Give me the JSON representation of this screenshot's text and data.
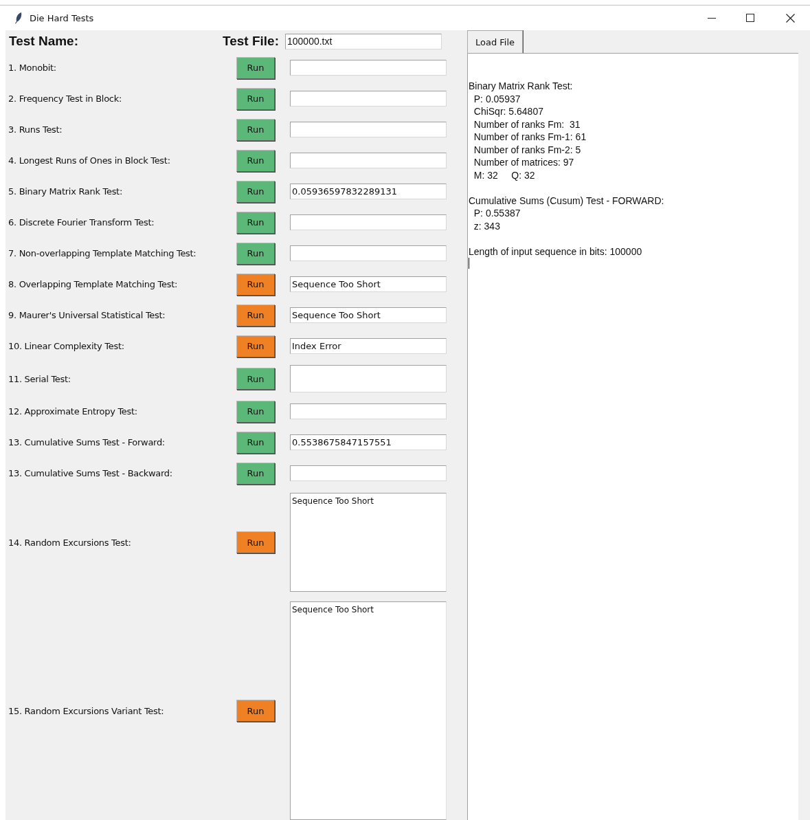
{
  "window": {
    "title": "Die Hard Tests"
  },
  "header": {
    "name_label": "Test Name:",
    "file_label": "Test File:",
    "file_value": "100000.txt"
  },
  "load_button": "Load File",
  "tests": [
    {
      "name": "1. Monobit:",
      "button": "Run",
      "color": "#5cb879",
      "kind": "entry"
    },
    {
      "name": "2. Frequency Test in Block:",
      "button": "Run",
      "color": "#5cb879",
      "kind": "entry"
    },
    {
      "name": "3. Runs Test:",
      "button": "Run",
      "color": "#5cb879",
      "kind": "entry"
    },
    {
      "name": "4. Longest Runs of Ones in Block Test:",
      "button": "Run",
      "color": "#5cb879",
      "kind": "entry"
    },
    {
      "name": "5. Binary Matrix Rank Test:",
      "button": "Run",
      "color": "#5cb879",
      "kind": "entry",
      "result": "0.05936597832289131"
    },
    {
      "name": "6. Discrete Fourier Transform Test:",
      "button": "Run",
      "color": "#5cb879",
      "kind": "entry"
    },
    {
      "name": "7. Non-overlapping Template Matching Test:",
      "button": "Run",
      "color": "#5cb879",
      "kind": "entry"
    },
    {
      "name": "8. Overlapping Template Matching Test:",
      "button": "Run",
      "color": "#f08024",
      "kind": "entry",
      "result": "Sequence Too Short"
    },
    {
      "name": "9. Maurer's Universal Statistical Test:",
      "button": "Run",
      "color": "#f08024",
      "kind": "entry",
      "result": "Sequence Too Short"
    },
    {
      "name": "10. Linear Complexity Test:",
      "button": "Run",
      "color": "#f08024",
      "kind": "entry",
      "result": "Index Error"
    },
    {
      "name": "11. Serial Test:",
      "button": "Run",
      "color": "#5cb879",
      "kind": "double"
    },
    {
      "name": "12. Approximate Entropy Test:",
      "button": "Run",
      "color": "#5cb879",
      "kind": "entry"
    },
    {
      "name": "13. Cumulative Sums Test - Forward:",
      "button": "Run",
      "color": "#5cb879",
      "kind": "entry",
      "result": "0.5538675847157551"
    },
    {
      "name": "13. Cumulative Sums Test - Backward:",
      "button": "Run",
      "color": "#5cb879",
      "kind": "entry"
    },
    {
      "name": "14. Random Excursions Test:",
      "button": "Run",
      "color": "#f08024",
      "kind": "box",
      "result": "Sequence Too Short"
    },
    {
      "name": "15. Random Excursions Variant Test:",
      "button": "Run",
      "color": "#f08024",
      "kind": "bigbox",
      "result": "Sequence Too Short"
    }
  ],
  "output": {
    "blocks": [
      {
        "lines": [
          "Binary Matrix Rank Test:",
          "  P: 0.05937",
          "  ChiSqr: 5.64807",
          "  Number of ranks Fm:  31",
          "  Number of ranks Fm-1: 61",
          "  Number of ranks Fm-2: 5",
          "  Number of matrices: 97",
          "  M: 32     Q: 32"
        ]
      },
      {
        "lines": [
          "Cumulative Sums (Cusum) Test - FORWARD:",
          "  P: 0.55387",
          "  z: 343"
        ]
      },
      {
        "lines": [
          "Length of input sequence in bits: 100000"
        ]
      }
    ]
  }
}
